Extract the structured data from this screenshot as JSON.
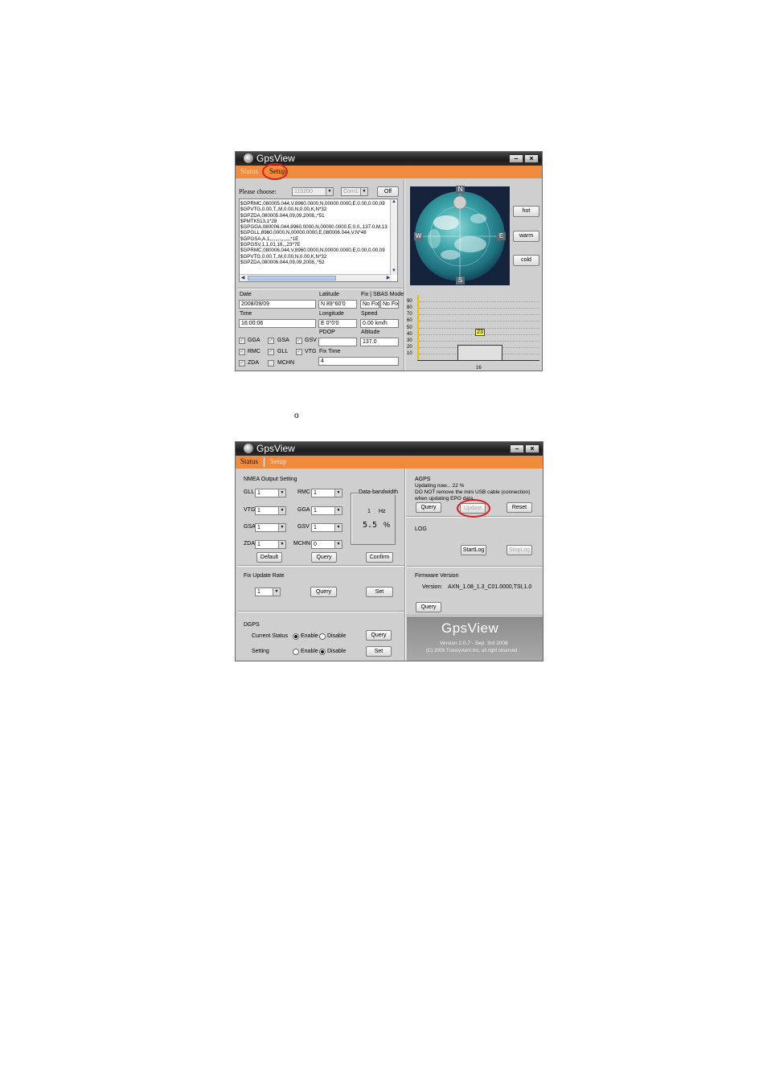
{
  "window1": {
    "title": "GpsView",
    "tabs": {
      "status": "Status",
      "setup": "Setup"
    },
    "choose_label": "Please choose:",
    "baud_select": "115200",
    "com_select": "Com1",
    "off_button": "Off",
    "nmea_log": [
      "$GPRMC,080005.044,V,8960.0000,N,00000.0000,E,0.00,0.00,09",
      "$GPVTG,0.00,T,,M,0.00,N,0.00,K,N*32",
      "$GPZDA,080005.044,09,09,2008,,*51",
      "$PMTK513,1*28",
      "$GPGGA,080006.044,8960.0000,N,00000.0000,E,0,0,,137.0,M,13",
      "$GPGLL,8960.0000,N,00000.0000,E,080006.044,V,N*48",
      "$GPGSA,A,1,,,,,,,,,,,,,,,*1E",
      "$GPGSV,1,1,01,16,,,23*7E",
      "$GPRMC,080006.044,V,8960.0000,N,00000.0000,E,0.00,0.00,09",
      "$GPVTG,0.00,T,,M,0.00,N,0.00,K,N*32",
      "$GPZDA,080006.044,09,09,2008,,*52"
    ],
    "compass": {
      "n": "N",
      "s": "S",
      "w": "W",
      "e": "E"
    },
    "start_buttons": {
      "hot": "hot",
      "warm": "warm",
      "cold": "cold"
    },
    "info": {
      "date_label": "Date",
      "date_value": "2008/09/09",
      "time_label": "Time",
      "time_value": "16:00:06",
      "latitude_label": "Latitude",
      "latitude_value": "N 89°60'0",
      "longitude_label": "Longitude",
      "longitude_value": "E 0°0'0",
      "pdop_label": "PDOP",
      "pdop_value": "",
      "fixtime_label": "Fix Time",
      "fixtime_value": "4",
      "fix_label": "Fix | SBAS Mode",
      "fix_value": "No Fix",
      "sbas_value": "No Fix",
      "speed_label": "Speed",
      "speed_value": "0.00 km/h",
      "altitude_label": "Altitude",
      "altitude_value": "137.0"
    },
    "checkboxes": {
      "gga": "GGA",
      "gsa": "GSA",
      "gsv": "GSV",
      "rmc": "RMC",
      "gll": "GLL",
      "vtg": "VTG",
      "zda": "ZDA",
      "mchn": "MCHN"
    },
    "snr_chart": {
      "y_ticks": [
        "90",
        "80",
        "70",
        "60",
        "50",
        "40",
        "30",
        "20",
        "10"
      ],
      "satellite_id": "16",
      "snr_value": "23",
      "snr": 23
    }
  },
  "caption_mark": "o",
  "window2": {
    "title": "GpsView",
    "tabs": {
      "status": "Status",
      "setup": "Setup"
    },
    "nmea": {
      "title": "NMEA Output Setting",
      "gll_label": "GLL",
      "gll_value": "1",
      "rmc_label": "RMC",
      "rmc_value": "1",
      "vtg_label": "VTG",
      "vtg_value": "1",
      "gga_label": "GGA",
      "gga_value": "1",
      "gsa_label": "GSA",
      "gsa_value": "1",
      "gsv_label": "GSV",
      "gsv_value": "1",
      "zda_label": "ZDA",
      "zda_value": "1",
      "mchn_label": "MCHN",
      "mchn_value": "0",
      "default_button": "Default",
      "query_button": "Query",
      "confirm_button": "Confirm",
      "bandwidth_title": "Data-bandwidth",
      "bandwidth_rate": "1",
      "bandwidth_unit": "Hz",
      "bandwidth_percent": "5.5",
      "bandwidth_pct_sign": "%"
    },
    "fix_update": {
      "title": "Fix Update Rate",
      "value": "1",
      "query_button": "Query",
      "set_button": "Set"
    },
    "dgps": {
      "title": "DGPS",
      "current_label": "Current Status",
      "setting_label": "Setting",
      "enable": "Enable",
      "disable": "Disable",
      "query_button": "Query",
      "set_button": "Set"
    },
    "agps": {
      "title": "AGPS",
      "line1": "Updating now... 22 %",
      "line2": "DO NOT remove the mini USB cable (connection)",
      "line3": "when updating EPO data",
      "query_button": "Query",
      "update_button": "Update",
      "reset_button": "Reset"
    },
    "log": {
      "title": "LOG",
      "start_button": "StartLog",
      "stop_button": "StopLog"
    },
    "firmware": {
      "title": "Firmware Version",
      "version_label": "Version:",
      "version_value": "AXN_1.08_1.3_C01.0000,TSI,1.0",
      "query_button": "Query"
    },
    "branding": {
      "logo": "GpsView",
      "version": "Version 2.0.7 - Sep. 3rd 2008",
      "copyright": "(C) 2008 Transystem Inc. all right reserved"
    }
  }
}
